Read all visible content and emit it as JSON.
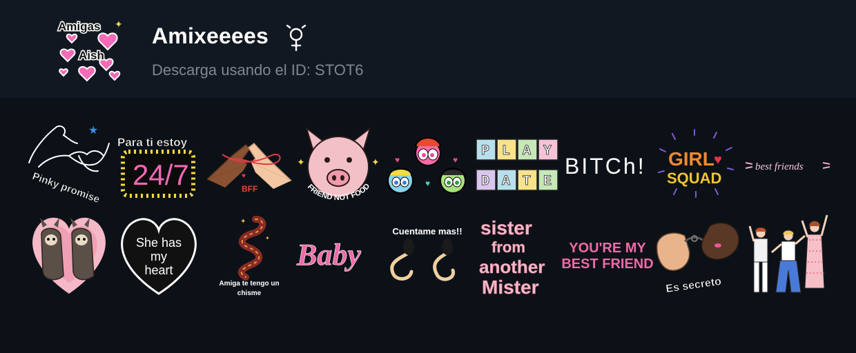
{
  "pack": {
    "title": "Amixeeees",
    "subtitle": "Descarga usando el ID: STOT6",
    "icon_text_line1": "Amigas",
    "icon_text_line2": "Aish",
    "badge_icon": "female-gender-icon"
  },
  "stickers": [
    {
      "name": "pinky-promise",
      "text": "Pinky promise"
    },
    {
      "name": "para-ti-estoy",
      "text_line1": "Para ti estoy",
      "text_line2": "24/7"
    },
    {
      "name": "bff-hands",
      "text": "BFF"
    },
    {
      "name": "pig",
      "text": "FRIEND NOT FOOD"
    },
    {
      "name": "powerpuff-girls"
    },
    {
      "name": "play-date",
      "letters_line1": [
        "P",
        "L",
        "A",
        "Y"
      ],
      "letters_line2": [
        "D",
        "A",
        "T",
        "E"
      ]
    },
    {
      "name": "bitch",
      "text": "BITCh!"
    },
    {
      "name": "girl-squad",
      "text_line1": "GIRL",
      "text_line2": "SQUAD"
    },
    {
      "name": "best-friends",
      "text": "best friends"
    },
    {
      "name": "sloths-heart"
    },
    {
      "name": "she-has-my-heart",
      "text_line1": "She has",
      "text_line2": "my",
      "text_line3": "heart"
    },
    {
      "name": "snake",
      "text_line1": "Amiga te tengo un",
      "text_line2": "chisme"
    },
    {
      "name": "baby",
      "text": "Baby"
    },
    {
      "name": "cuentame-mas",
      "text": "Cuentame mas!!"
    },
    {
      "name": "sister-mister",
      "text_line1": "sister",
      "text_line2": "from",
      "text_line3": "another",
      "text_line4": "Mister"
    },
    {
      "name": "youre-my-best-friend",
      "text_line1": "YOU'RE MY",
      "text_line2": "BEST FRIEND"
    },
    {
      "name": "es-secreto",
      "text": "Es secreto"
    },
    {
      "name": "three-girls"
    }
  ],
  "colors": {
    "background": "#0c1117",
    "header": "#121821",
    "pink": "#f06aa8",
    "title": "#ffffff",
    "subtitle": "#7f8790"
  }
}
